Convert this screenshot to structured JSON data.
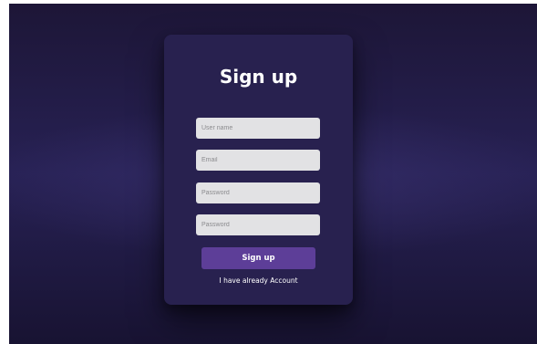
{
  "form": {
    "title": "Sign up",
    "fields": [
      {
        "placeholder": "User name",
        "value": ""
      },
      {
        "placeholder": "Email",
        "value": ""
      },
      {
        "placeholder": "Password",
        "value": ""
      },
      {
        "placeholder": "Password",
        "value": ""
      }
    ],
    "submit_label": "Sign up",
    "login_link": "I have already Account"
  },
  "colors": {
    "background": "#221c47",
    "card": "#28214f",
    "input_fill": "#e2e2e4",
    "button": "#5d3e98",
    "text": "#ffffff"
  }
}
